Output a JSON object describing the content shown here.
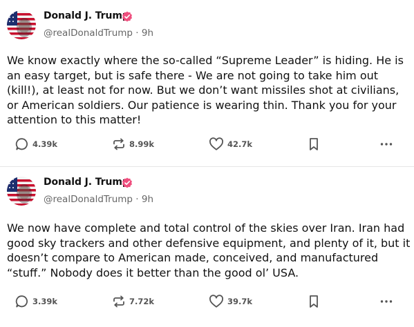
{
  "posts": [
    {
      "author": {
        "name": "Donald J. Trump",
        "handle": "@realDonaldTrump",
        "separator": "·",
        "time": "9h",
        "verified": true
      },
      "text": "We know exactly where the so-called “Supreme Leader” is hiding. He is an easy target, but is safe there - We are not going to take him out (kill!), at least not for now. But we don’t want missiles shot at civilians, or American soldiers. Our patience is wearing thin. Thank you for your attention to this matter!",
      "stats": {
        "replies": "4.39k",
        "reposts": "8.99k",
        "likes": "42.7k"
      }
    },
    {
      "author": {
        "name": "Donald J. Trump",
        "handle": "@realDonaldTrump",
        "separator": "·",
        "time": "9h",
        "verified": true
      },
      "text": "We now have complete and total control of the skies over Iran. Iran had good sky trackers and other defensive equipment, and plenty of it, but it doesn’t compare to American made, conceived, and manufactured “stuff.” Nobody does it better than the good ol’ USA.",
      "stats": {
        "replies": "3.39k",
        "reposts": "7.72k",
        "likes": "39.7k"
      }
    }
  ],
  "icons": {
    "reply": "speech-bubble-icon",
    "repost": "repost-arrows-icon",
    "like": "heart-outline-icon",
    "save": "bookmark-icon",
    "more": "more-dots-icon",
    "verified": "verified-badge-icon"
  },
  "colors": {
    "verified_badge": "#ef4f7e",
    "text_primary": "#111111",
    "text_secondary": "#666666",
    "icon_gray": "#555555",
    "separator": "#e6e6e6"
  }
}
